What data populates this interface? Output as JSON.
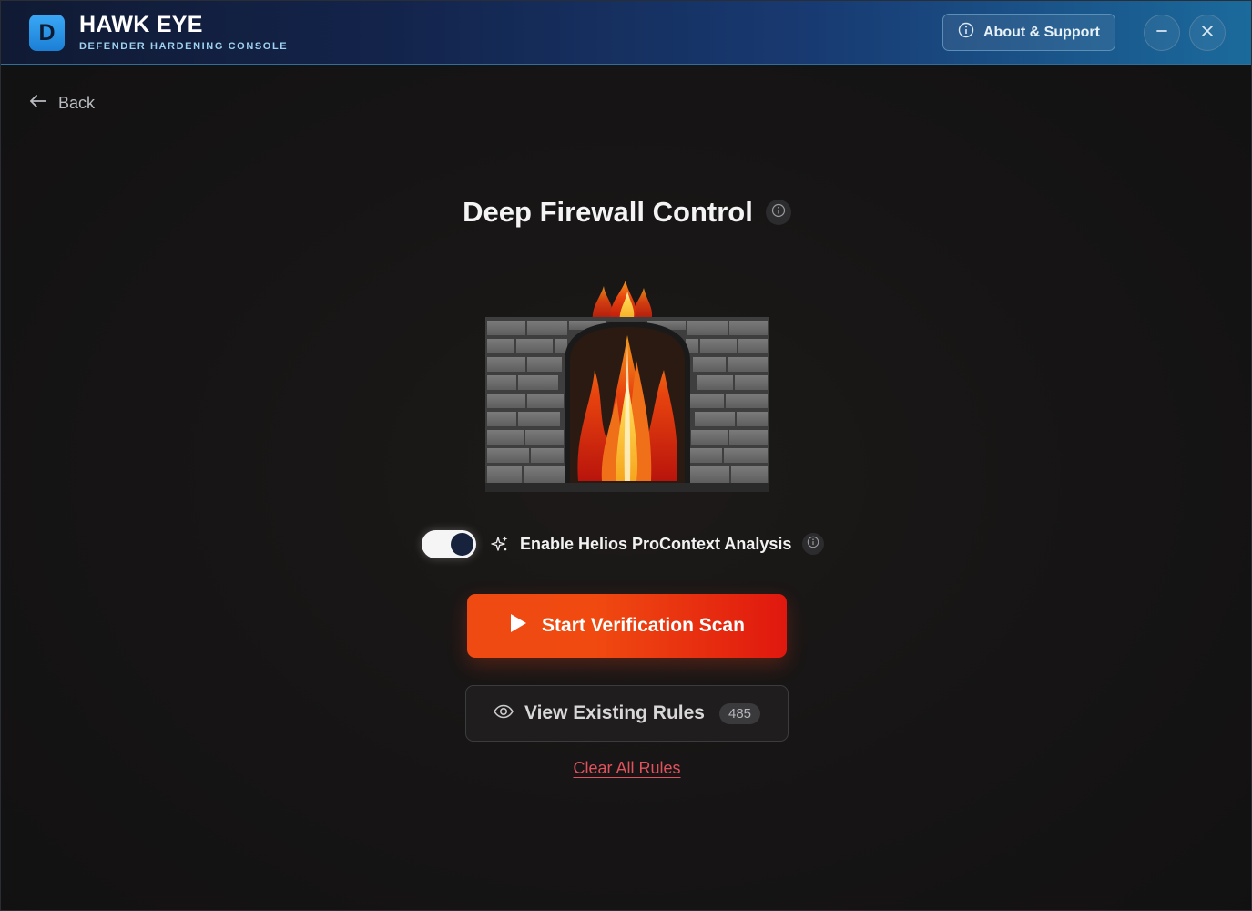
{
  "header": {
    "logo_letter": "D",
    "title": "HAWK EYE",
    "subtitle": "DEFENDER HARDENING CONSOLE",
    "about_label": "About & Support"
  },
  "nav": {
    "back_label": "Back"
  },
  "main": {
    "title": "Deep Firewall Control",
    "toggle": {
      "label": "Enable Helios ProContext Analysis",
      "enabled": true
    },
    "start_scan_label": "Start Verification Scan",
    "view_rules_label": "View Existing Rules",
    "rules_count": "485",
    "clear_rules_label": "Clear All Rules"
  },
  "icons": {
    "info": "info-icon",
    "minimize": "minimize-icon",
    "close": "close-icon",
    "back": "arrow-left-icon",
    "sparkle": "sparkle-icon",
    "play": "play-icon",
    "eye": "eye-icon",
    "illustration": "firewall-illustration"
  },
  "colors": {
    "header_gradient_start": "#101a33",
    "header_gradient_end": "#1b6a9c",
    "accent_orange": "#ee4a12",
    "accent_red": "#e0180f",
    "danger_link": "#e0525c",
    "background": "#151313"
  }
}
